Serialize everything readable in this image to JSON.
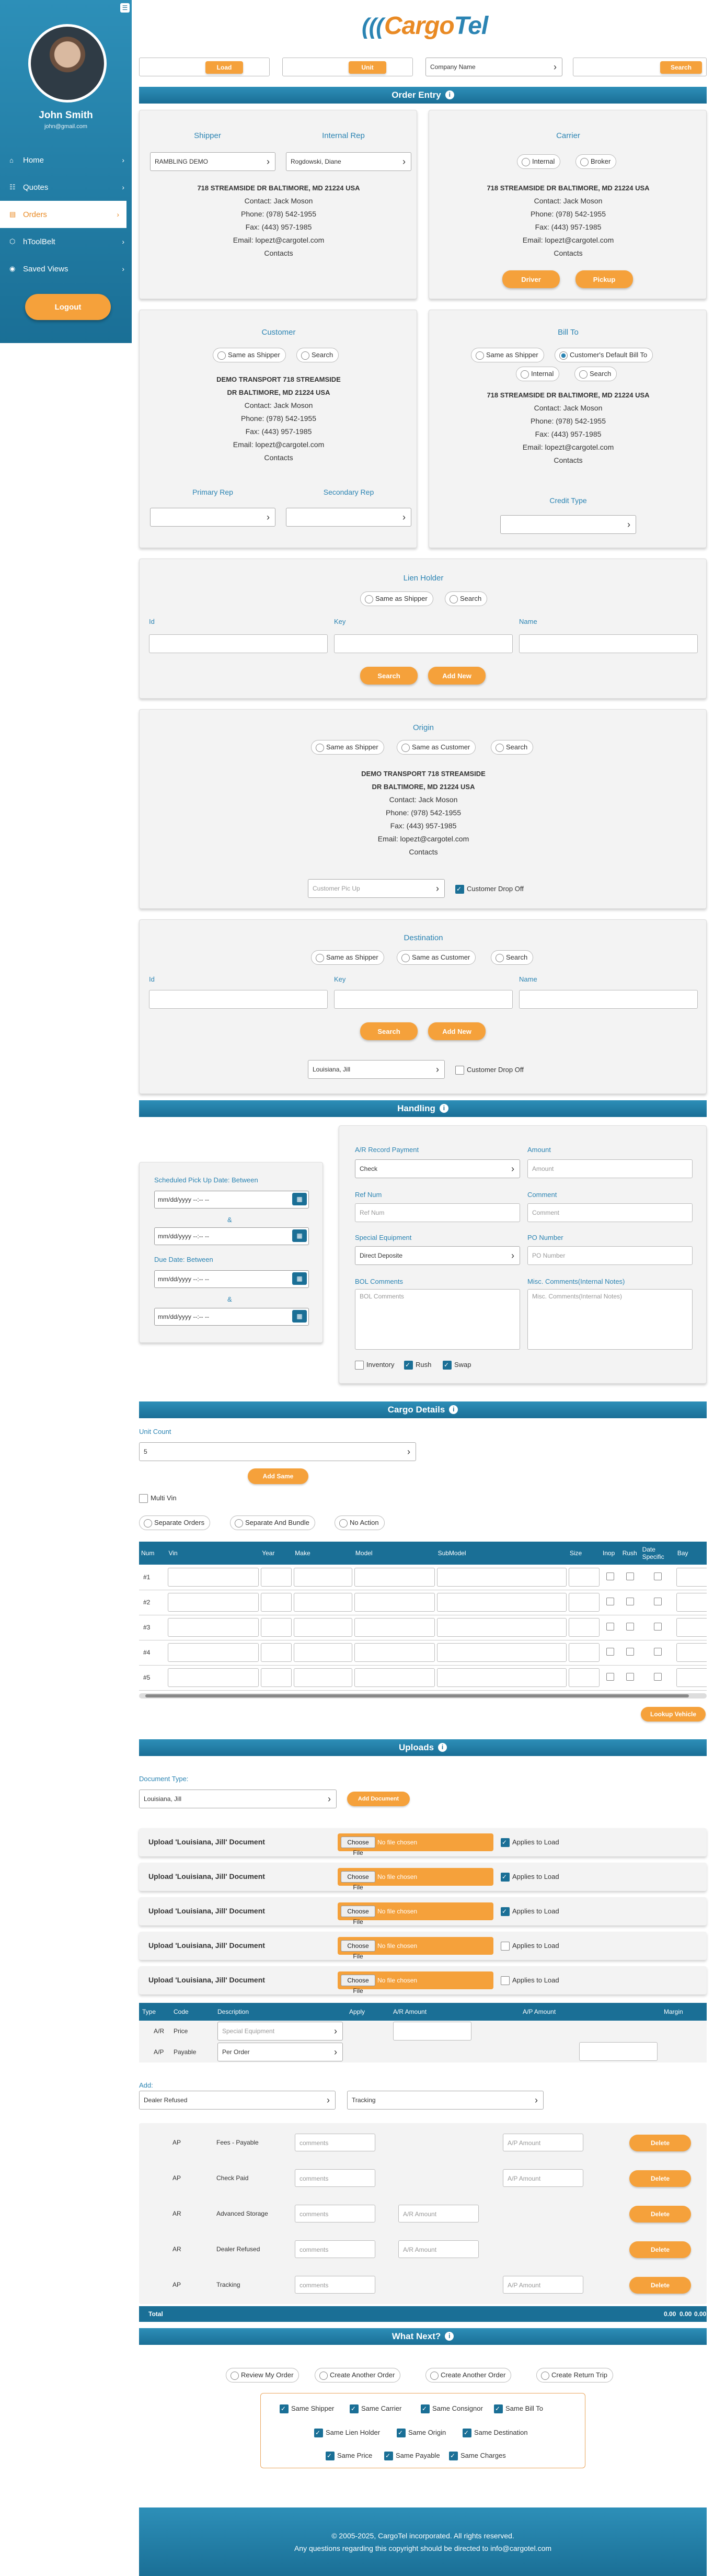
{
  "user": {
    "name": "John Smith",
    "email": "john@gmail.com"
  },
  "nav": [
    {
      "icon": "⌂",
      "label": "Home"
    },
    {
      "icon": "☷",
      "label": "Quotes"
    },
    {
      "icon": "▤",
      "label": "Orders"
    },
    {
      "icon": "⬡",
      "label": "hToolBelt"
    },
    {
      "icon": "◉",
      "label": "Saved Views"
    }
  ],
  "logout_label": "Logout",
  "logo": {
    "part1": "Cargo",
    "part2": "Tel",
    "arcs": "((("
  },
  "topbar": {
    "load": "Load",
    "unit": "Unit",
    "company_placeholder": "Company Name",
    "search": "Search"
  },
  "sections": {
    "order_entry": "Order Entry",
    "handling": "Handling",
    "cargo": "Cargo Details",
    "uploads": "Uploads",
    "next": "What Next?",
    "info": "i"
  },
  "shipper": {
    "title": "Shipper",
    "value": "RAMBLING DEMO",
    "internal_rep_title": "Internal Rep",
    "internal_rep": "Rogdowski, Diane",
    "addr1": "718 STREAMSIDE DR BALTIMORE, MD 21224 USA",
    "contact": "Contact: Jack Moson",
    "phone": "Phone: (978) 542-1955",
    "fax": "Fax: (443) 957-1985",
    "email": "Email: lopezt@cargotel.com",
    "contacts": "Contacts"
  },
  "carrier": {
    "title": "Carrier",
    "opt1": "Internal",
    "opt2": "Broker",
    "addr1": "718 STREAMSIDE DR BALTIMORE, MD 21224 USA",
    "contact": "Contact: Jack Moson",
    "phone": "Phone: (978) 542-1955",
    "fax": "Fax: (443) 957-1985",
    "email": "Email: lopezt@cargotel.com",
    "contacts": "Contacts",
    "btn1": "Driver",
    "btn2": "Pickup"
  },
  "customer": {
    "title": "Customer",
    "opt1": "Same as Shipper",
    "opt2": "Search",
    "addr1": "DEMO TRANSPORT 718 STREAMSIDE",
    "addr2": "DR BALTIMORE, MD 21224 USA",
    "contact": "Contact: Jack Moson",
    "phone": "Phone: (978) 542-1955",
    "fax": "Fax: (443) 957-1985",
    "email": "Email: lopezt@cargotel.com",
    "contacts": "Contacts",
    "primary": "Primary Rep",
    "secondary": "Secondary Rep"
  },
  "billto": {
    "title": "Bill To",
    "opt1": "Same as Shipper",
    "opt2": "Customer's Default Bill To",
    "opt3": "Internal",
    "opt4": "Search",
    "addr1": "718 STREAMSIDE DR BALTIMORE, MD 21224 USA",
    "contact": "Contact: Jack Moson",
    "phone": "Phone: (978) 542-1955",
    "fax": "Fax: (443) 957-1985",
    "email": "Email: lopezt@cargotel.com",
    "contacts": "Contacts",
    "credit": "Credit Type"
  },
  "lien": {
    "title": "Lien Holder",
    "opt1": "Same as Shipper",
    "opt2": "Search",
    "id": "Id",
    "key": "Key",
    "name": "Name",
    "search": "Search",
    "add": "Add New"
  },
  "origin": {
    "title": "Origin",
    "opt1": "Same as Shipper",
    "opt2": "Same as Customer",
    "opt3": "Search",
    "addr1": "DEMO TRANSPORT 718 STREAMSIDE",
    "addr2": "DR BALTIMORE, MD 21224 USA",
    "contact": "Contact: Jack Moson",
    "phone": "Phone: (978) 542-1955",
    "fax": "Fax: (443) 957-1985",
    "email": "Email: lopezt@cargotel.com",
    "contacts": "Contacts",
    "pickup_ph": "Customer Pic Up",
    "dropoff": "Customer Drop Off"
  },
  "destination": {
    "title": "Destination",
    "opt1": "Same as Shipper",
    "opt2": "Same as Customer",
    "opt3": "Search",
    "id": "Id",
    "key": "Key",
    "name": "Name",
    "search": "Search",
    "add": "Add New",
    "rep": "Louisiana, Jill",
    "dropoff": "Customer Drop Off"
  },
  "handling": {
    "pickup_label": "Scheduled Pick Up Date: Between",
    "and": "&",
    "due_label": "Due Date: Between",
    "date_ph": "mm/dd/yyyy --:-- --",
    "ar_label": "A/R Record Payment",
    "ar_value": "Check",
    "amount_label": "Amount",
    "amount_ph": "Amount",
    "ref_label": "Ref Num",
    "ref_ph": "Ref Num",
    "comment_label": "Comment",
    "comment_ph": "Comment",
    "equip_label": "Special Equipment",
    "equip_value": "Direct Deposite",
    "po_label": "PO Number",
    "po_ph": "PO Number",
    "bol_label": "BOL Comments",
    "bol_ph": "BOL Comments",
    "misc_label": "Misc. Comments(Internal Notes)",
    "misc_ph": "Misc. Comments(Internal Notes)",
    "inv": "Inventory",
    "rush": "Rush",
    "swap": "Swap"
  },
  "cargo": {
    "unit_label": "Unit Count",
    "unit_value": "5",
    "add_same": "Add Same",
    "multi": "Multi Vin",
    "opt1": "Separate Orders",
    "opt2": "Separate And Bundle",
    "opt3": "No Action",
    "lookup": "Lookup Vehicle",
    "columns": [
      "Num",
      "Vin",
      "Year",
      "Make",
      "Model",
      "SubModel",
      "Size",
      "Inop",
      "Rush",
      "Date Specific",
      "Bay"
    ],
    "rows": [
      "#1",
      "#2",
      "#3",
      "#4",
      "#5"
    ]
  },
  "uploads": {
    "doc_type_label": "Document Type:",
    "doc_type": "Louisiana, Jill",
    "add_doc": "Add Document",
    "choose": "Choose File",
    "no_file": "No file chosen",
    "applies": "Applies to Load",
    "rows": [
      {
        "label": "Upload 'Louisiana, Jill' Document",
        "checked": true
      },
      {
        "label": "Upload 'Louisiana, Jill' Document",
        "checked": true
      },
      {
        "label": "Upload 'Louisiana, Jill' Document",
        "checked": true
      },
      {
        "label": "Upload 'Louisiana, Jill' Document",
        "checked": false
      },
      {
        "label": "Upload 'Louisiana, Jill' Document",
        "checked": false
      }
    ]
  },
  "acct": {
    "cols": [
      "Type",
      "Code",
      "Description",
      "Apply",
      "A/R Amount",
      "A/P Amount",
      "Margin"
    ],
    "r1": {
      "type": "A/R",
      "code": "Price",
      "desc": "Special Equipment"
    },
    "r2": {
      "type": "A/P",
      "code": "Payable",
      "desc": "Per Order"
    },
    "add": "Add:",
    "add_sel1": "Dealer Refused",
    "add_sel2": "Tracking",
    "comments_ph": "comments",
    "ar_ph": "A/R Amount",
    "ap_ph": "A/P Amount",
    "delete": "Delete",
    "lines": [
      {
        "type": "AP",
        "code": "Fees - Payable"
      },
      {
        "type": "AP",
        "code": "Check Paid"
      },
      {
        "type": "AR",
        "code": "Advanced Storage"
      },
      {
        "type": "AR",
        "code": "Dealer Refused"
      },
      {
        "type": "AP",
        "code": "Tracking"
      }
    ],
    "total_label": "Total",
    "t1": "0.00",
    "t2": "0.00",
    "t3": "0.00"
  },
  "next": {
    "opt1": "Review My Order",
    "opt2": "Create Another Order",
    "opt3": "Create Another Order",
    "opt4": "Create Return Trip",
    "checks1": [
      "Same Shipper",
      "Same Carrier",
      "Same Consignor",
      "Same Bill To"
    ],
    "checks2": [
      "Same Lien Holder",
      "Same Origin",
      "Same Destination"
    ],
    "checks3": [
      "Same Price",
      "Same Payable",
      "Same Charges"
    ]
  },
  "footer": {
    "line1": "© 2005-2025, CargoTel incorporated. All rights reserved.",
    "line2": "Any questions regarding this copyright should be directed to info@cargotel.com"
  }
}
